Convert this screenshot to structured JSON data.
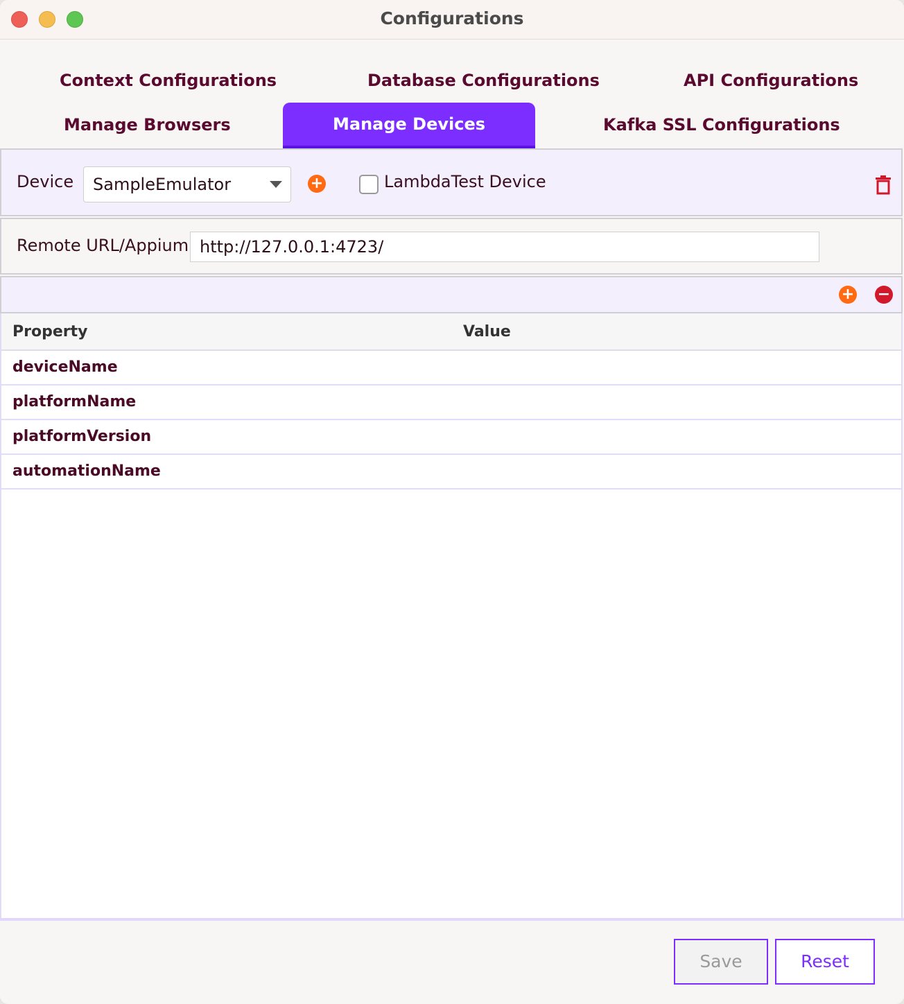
{
  "window": {
    "title": "Configurations"
  },
  "tabs": [
    {
      "label": "Context Configurations"
    },
    {
      "label": "Database Configurations"
    },
    {
      "label": "API Configurations"
    },
    {
      "label": "Manage Browsers"
    },
    {
      "label": "Manage Devices",
      "active": true
    },
    {
      "label": "Kafka SSL Configurations"
    }
  ],
  "device": {
    "label": "Device",
    "selected": "SampleEmulator",
    "lambdatest_label": "LambdaTest Device",
    "lambdatest_checked": false
  },
  "remote": {
    "label": "Remote URL/Appium",
    "value": "http://127.0.0.1:4723/"
  },
  "table": {
    "headers": [
      "Property",
      "Value"
    ],
    "rows": [
      {
        "property": "deviceName",
        "value": ""
      },
      {
        "property": "platformName",
        "value": ""
      },
      {
        "property": "platformVersion",
        "value": ""
      },
      {
        "property": "automationName",
        "value": ""
      }
    ]
  },
  "footer": {
    "save_label": "Save",
    "reset_label": "Reset"
  },
  "colors": {
    "accent": "#7b2eff",
    "add": "#ff6a13",
    "remove": "#d2182b",
    "text": "#5a0a2e"
  }
}
